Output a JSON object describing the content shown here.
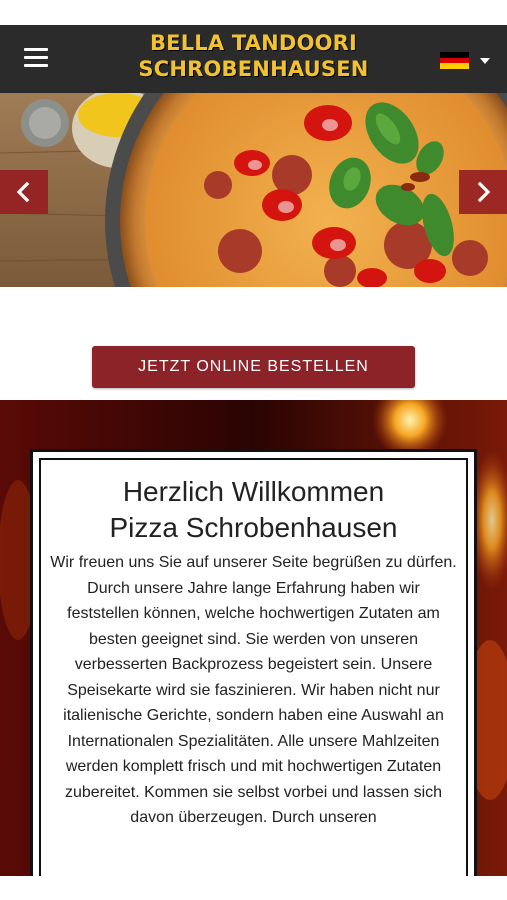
{
  "header": {
    "brand_line1": "BELLA TANDOORI",
    "brand_line2": "SCHROBENHAUSEN",
    "menu_icon": "hamburger-icon",
    "language_icon": "germany-flag-icon",
    "brand_color": "#f2c230",
    "bar_color": "#2b2b2b"
  },
  "hero": {
    "image": "pizza-photo",
    "prev_icon": "chevron-left-icon",
    "next_icon": "chevron-right-icon"
  },
  "cta": {
    "label": "JETZT ONLINE BESTELLEN",
    "color": "#8c2329"
  },
  "welcome": {
    "title_line1": "Herzlich Willkommen",
    "title_line2": "Pizza Schrobenhausen",
    "text": "Wir freuen uns Sie auf unserer Seite begrüßen zu dürfen. Durch unsere Jahre lange Erfahrung haben wir feststellen können, welche hochwertigen Zutaten am besten geeignet sind. Sie werden von unseren verbesserten Backprozess begeistert sein. Unsere Speisekarte wird sie faszinieren. Wir haben nicht nur italienische Gerichte, sondern haben eine Auswahl an Internationalen Spezialitäten. Alle unsere Mahlzeiten werden komplett frisch und mit hochwertigen Zutaten zubereitet. Kommen sie selbst vorbei und lassen sich davon überzeugen. Durch unseren"
  }
}
